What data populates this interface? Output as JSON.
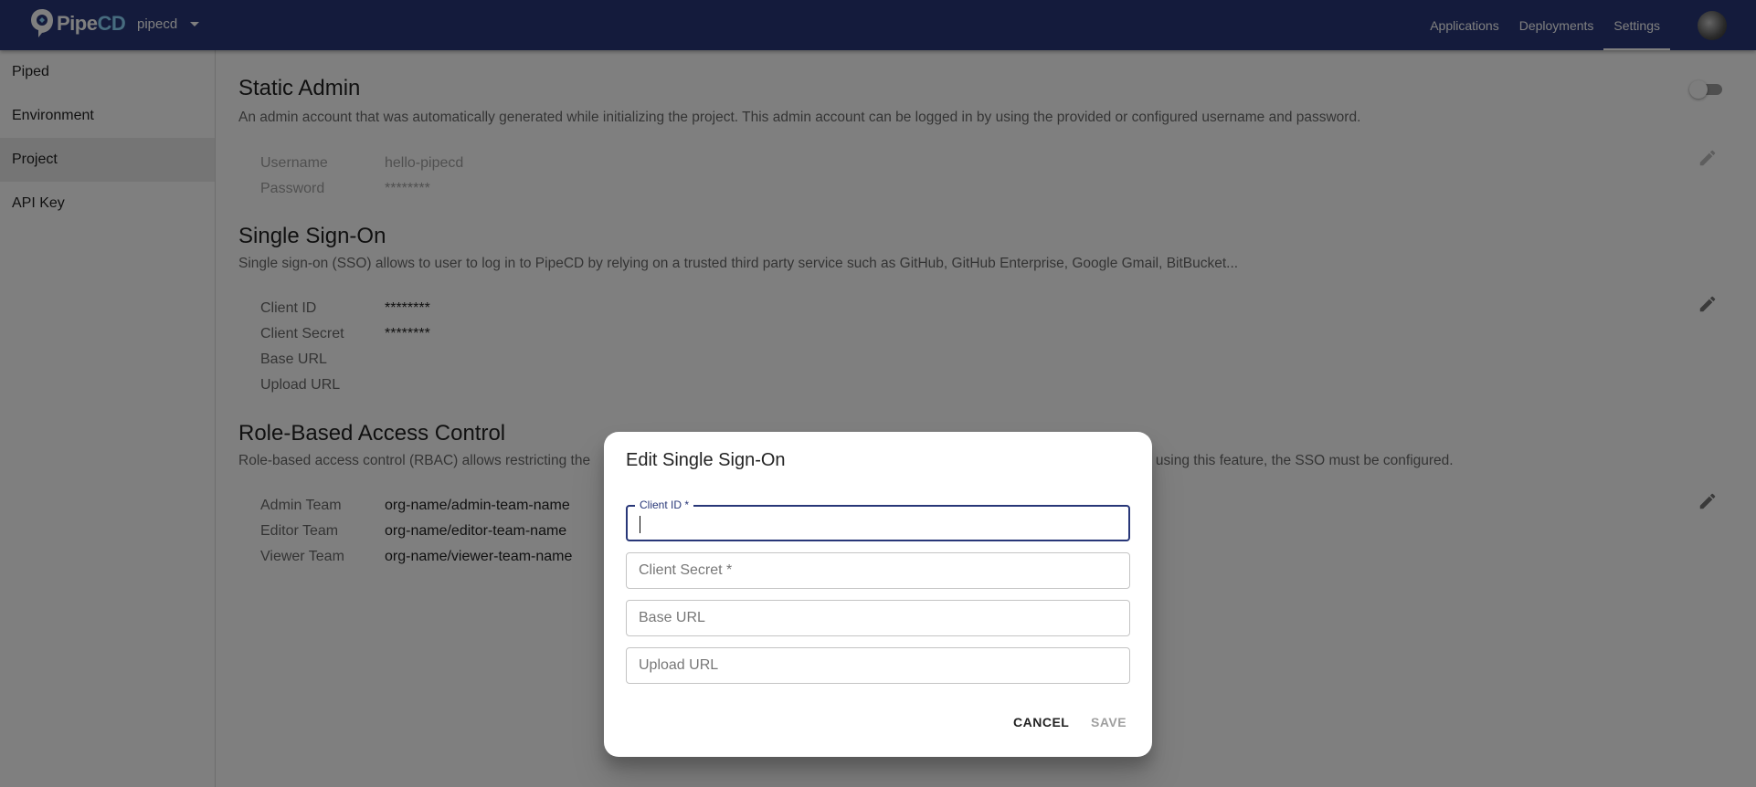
{
  "header": {
    "logo_text_1": "Pipe",
    "logo_text_2": "CD",
    "project": "pipecd",
    "nav": [
      "Applications",
      "Deployments",
      "Settings"
    ],
    "active_nav": "Settings"
  },
  "sidebar": {
    "items": [
      {
        "label": "Piped"
      },
      {
        "label": "Environment"
      },
      {
        "label": "Project"
      },
      {
        "label": "API Key"
      }
    ],
    "selected": "Project"
  },
  "static_admin": {
    "title": "Static Admin",
    "description": "An admin account that was automatically generated while initializing the project. This admin account can be logged in by using the provided or configured username and password.",
    "username_label": "Username",
    "username_value": "hello-pipecd",
    "password_label": "Password",
    "password_value": "********"
  },
  "sso": {
    "title": "Single Sign-On",
    "description": "Single sign-on (SSO) allows to user to log in to PipeCD by relying on a trusted third party service such as GitHub, GitHub Enterprise, Google Gmail, BitBucket...",
    "client_id_label": "Client ID",
    "client_id_value": "********",
    "client_secret_label": "Client Secret",
    "client_secret_value": "********",
    "base_url_label": "Base URL",
    "upload_url_label": "Upload URL"
  },
  "rbac": {
    "title": "Role-Based Access Control",
    "description_left": "Role-based access control (RBAC) allows restricting the",
    "description_right": "e using this feature, the SSO must be configured.",
    "admin_label": "Admin Team",
    "admin_value": "org-name/admin-team-name",
    "editor_label": "Editor Team",
    "editor_value": "org-name/editor-team-name",
    "viewer_label": "Viewer Team",
    "viewer_value": "org-name/viewer-team-name"
  },
  "dialog": {
    "title": "Edit Single Sign-On",
    "client_id_label": "Client ID *",
    "client_secret_placeholder": "Client Secret *",
    "base_url_placeholder": "Base URL",
    "upload_url_placeholder": "Upload URL",
    "cancel": "CANCEL",
    "save": "SAVE"
  },
  "colors": {
    "appbar": "#283778",
    "primary": "#283778"
  }
}
